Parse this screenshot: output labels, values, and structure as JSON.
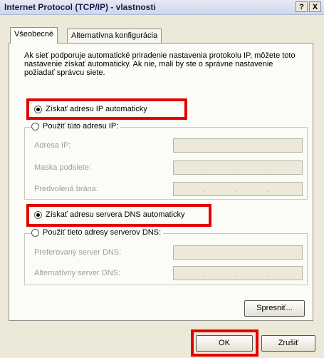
{
  "window": {
    "title": "Internet Protocol (TCP/IP) - vlastnosti",
    "help_label": "?",
    "close_label": "X"
  },
  "tabs": [
    {
      "label": "Všeobecné"
    },
    {
      "label": "Alternatívna konfigurácia"
    }
  ],
  "description": "Ak sieť podporuje automatické priradenie nastavenia protokolu IP, môžete toto nastavenie získať automaticky. Ak nie, mali by ste o správne nastavenie požiadať správcu siete.",
  "ip_section": {
    "auto_label": "Získať adresu IP automaticky",
    "manual_label": "Použiť túto adresu IP:",
    "fields": [
      {
        "label": "Adresa IP:"
      },
      {
        "label": "Maska podsiete:"
      },
      {
        "label": "Predvolená brána:"
      }
    ]
  },
  "dns_section": {
    "auto_label": "Získať adresu servera DNS automaticky",
    "manual_label": "Použiť tieto adresy serverov DNS:",
    "fields": [
      {
        "label": "Preferovaný server DNS:"
      },
      {
        "label": "Alternatívny server DNS:"
      }
    ]
  },
  "buttons": {
    "advanced": "Spresniť...",
    "ok": "OK",
    "cancel": "Zrušiť"
  },
  "colors": {
    "highlight": "#e30000",
    "dialog_bg": "#ece9d8"
  }
}
